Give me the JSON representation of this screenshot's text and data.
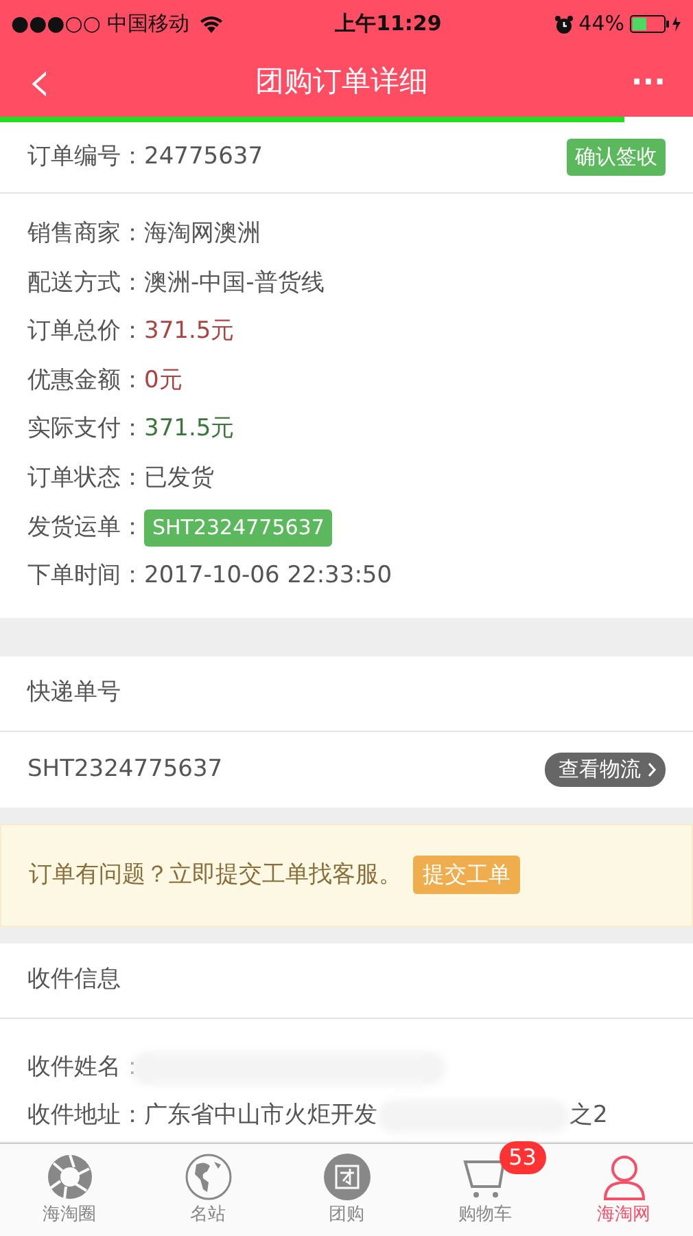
{
  "status_bar": {
    "carrier": "●●●○○ 中国移动",
    "time": "上午11:29",
    "battery_text": "44%"
  },
  "header": {
    "back": "‹",
    "title": "团购订单详细",
    "more": "···"
  },
  "loading_bar": {
    "level": 0.9
  },
  "order": {
    "label": "订单编号：",
    "value": "24775637",
    "action": "确认签收"
  },
  "details": [
    {
      "label": "销售商家：",
      "value": "海淘网澳洲",
      "kind": "plain"
    },
    {
      "label": "配送方式：",
      "value": "澳洲-中国-普货线",
      "kind": "plain"
    },
    {
      "label": "订单总价：",
      "value": "371.5元",
      "kind": "price"
    },
    {
      "label": "优惠金额：",
      "value": "0元",
      "kind": "price"
    },
    {
      "label": "实际支付：",
      "value": "371.5元",
      "kind": "paid"
    },
    {
      "label": "订单状态：",
      "value": "已发货",
      "kind": "plain"
    },
    {
      "label": "发货运单：",
      "value": "SHT2324775637",
      "kind": "tag"
    },
    {
      "label": "下单时间：",
      "value": "2017-10-06 22:33:50",
      "kind": "plain"
    }
  ],
  "express": {
    "title": "快递单号",
    "number": "SHT2324775637",
    "action": "查看物流"
  },
  "notice": {
    "text": "订单有问题？立即提交工单找客服。",
    "action": "提交工单"
  },
  "receiver": {
    "title": "收件信息",
    "rows": [
      {
        "label": "收件姓名："
      },
      {
        "label": "收件地址：",
        "value": "广东省中山市火炬开发",
        "tail": "之2"
      }
    ]
  },
  "tabbar": [
    {
      "label": "海淘圈",
      "kind": "aperture",
      "selected": false
    },
    {
      "label": "名站",
      "kind": "globe",
      "selected": false
    },
    {
      "label": "团购",
      "kind": "group",
      "selected": false
    },
    {
      "label": "购物车",
      "kind": "cart",
      "selected": false,
      "badge": "53"
    },
    {
      "label": "海淘网",
      "kind": "person",
      "selected": true
    }
  ]
}
